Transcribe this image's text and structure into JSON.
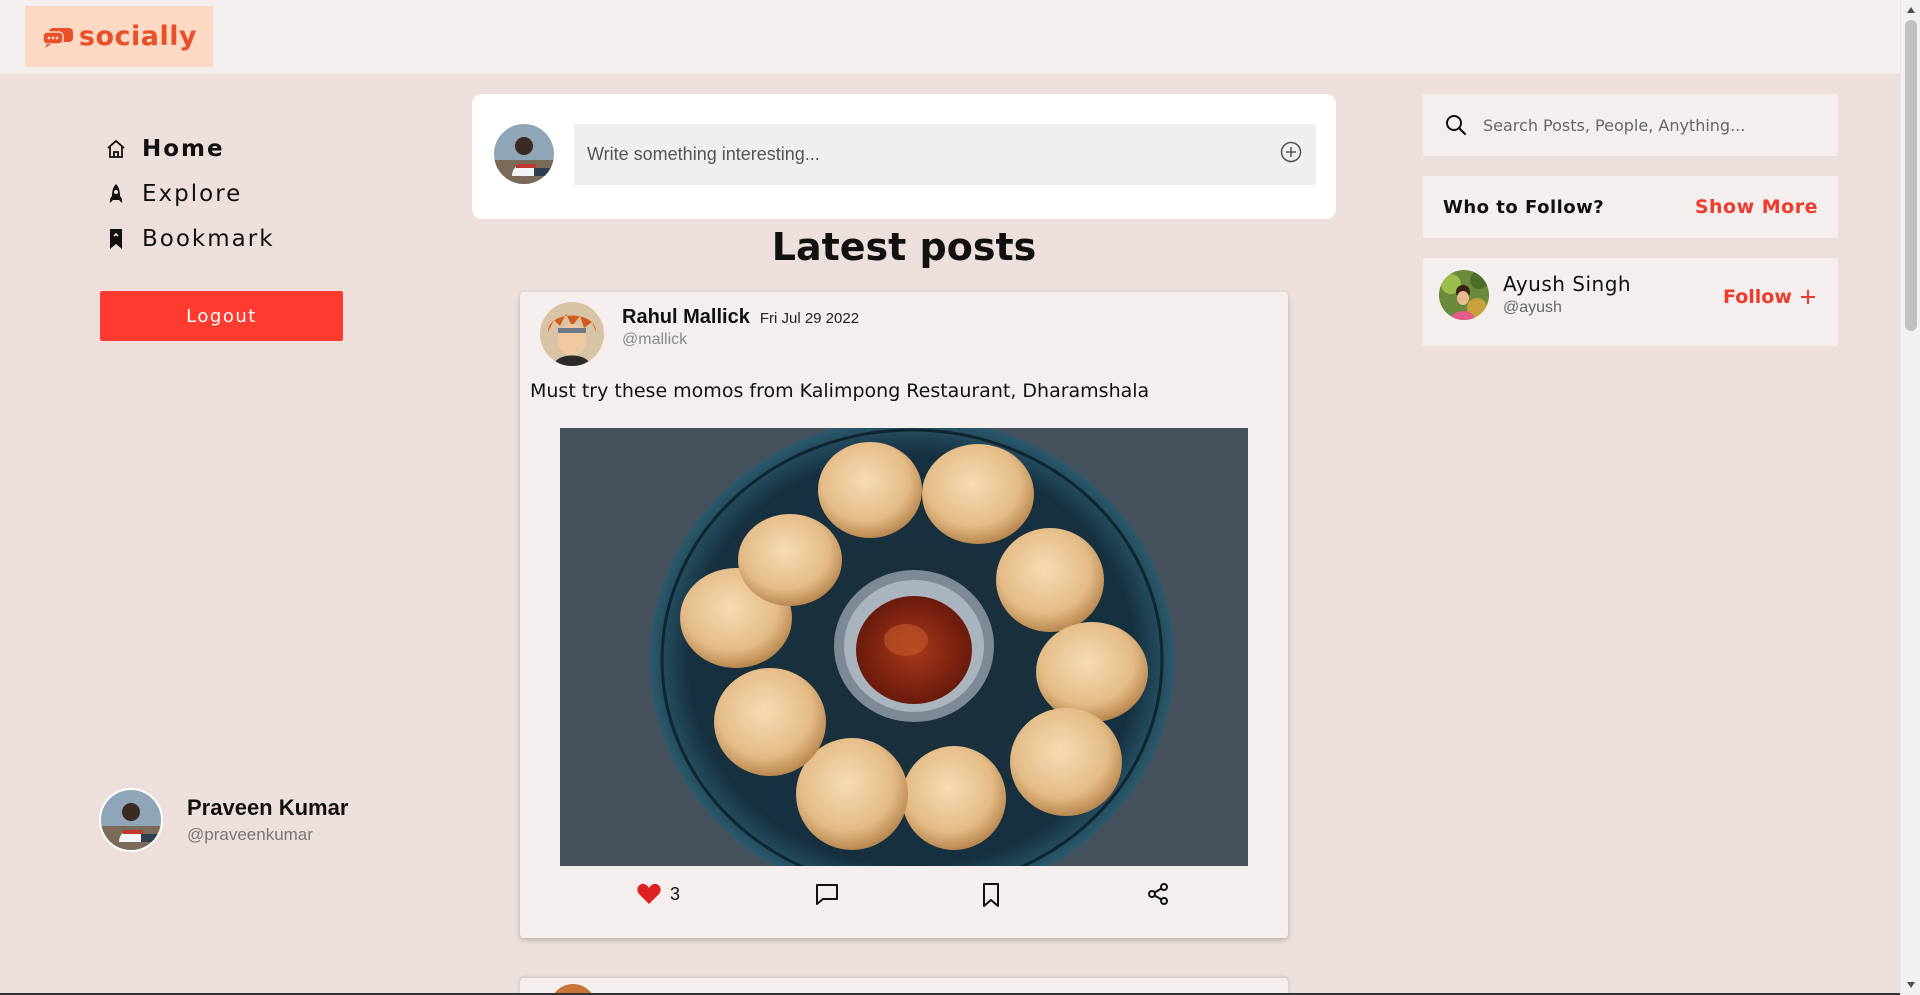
{
  "brand": {
    "name": "socially",
    "accent": "#e8502a",
    "logo_bg": "#fbd9c2"
  },
  "nav": {
    "items": [
      {
        "label": "Home",
        "icon": "home-icon",
        "active": true
      },
      {
        "label": "Explore",
        "icon": "rocket-icon",
        "active": false
      },
      {
        "label": "Bookmark",
        "icon": "bookmark-icon",
        "active": false
      }
    ],
    "logout_label": "Logout"
  },
  "current_user": {
    "name": "Praveen Kumar",
    "handle": "@praveenkumar"
  },
  "composer": {
    "placeholder": "Write something interesting..."
  },
  "feed": {
    "title": "Latest posts",
    "posts": [
      {
        "author": "Rahul Mallick",
        "date": "Fri Jul 29 2022",
        "handle": "@mallick",
        "text": "Must try these momos from Kalimpong Restaurant, Dharamshala",
        "likes": "3",
        "liked": true
      }
    ]
  },
  "search": {
    "placeholder": "Search Posts, People, Anything..."
  },
  "who_to_follow": {
    "title": "Who to Follow?",
    "show_more_label": "Show More",
    "suggestions": [
      {
        "name": "Ayush Singh",
        "handle": "@ayush",
        "follow_label": "Follow"
      }
    ]
  },
  "colors": {
    "background": "#ede0dc",
    "danger": "#ff3b30",
    "accent_red": "#ee3b2c",
    "like_red": "#e0201e"
  }
}
